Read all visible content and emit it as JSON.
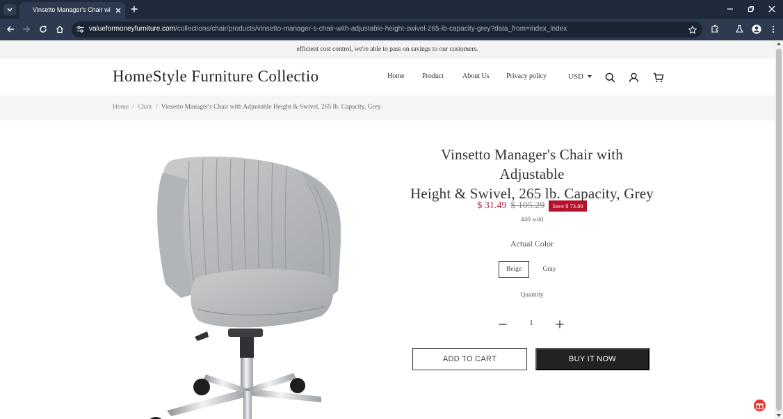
{
  "browser": {
    "tab_title": "Vinsetto Manager's Chair with Adjustable Height",
    "url_host": "valueformoneyfurniture.com",
    "url_path": "/collections/chair/products/vinsetto-manager-s-chair-with-adjustable-height-swivel-265-lb-capacity-grey?data_from=index_index"
  },
  "announcement": "efficient cost control, we're able to pass on savings to our customers.",
  "header": {
    "logo": "HomeStyle Furniture Collectio",
    "nav": [
      "Home",
      "Product",
      "About Us",
      "Privacy policy"
    ],
    "currency": "USD"
  },
  "breadcrumb": {
    "items": [
      "Home",
      "Chair"
    ],
    "current": "Vinsetto Manager's Chair with Adjustable Height & Swivel, 265 lb. Capacity, Grey"
  },
  "product": {
    "title_line1": "Vinsetto Manager's Chair with Adjustable",
    "title_line2": "Height & Swivel, 265 lb. Capacity, Grey",
    "price": "$ 31.49",
    "compare_price": "$ 105.29",
    "save_badge": "Save $ 73.80",
    "sold": "440 sold",
    "color_label": "Actual Color",
    "colors": [
      "Beige",
      "Gray"
    ],
    "selected_color": "Beige",
    "quantity_label": "Quantity",
    "quantity": "1",
    "add_to_cart": "ADD TO CART",
    "buy_now": "BUY IT NOW"
  },
  "colors": {
    "sale": "#c0193a",
    "badge": "#b3122c",
    "chrome_dark": "#1f2b3d",
    "chrome_mid": "#2d3a4f",
    "button_dark": "#222222"
  }
}
